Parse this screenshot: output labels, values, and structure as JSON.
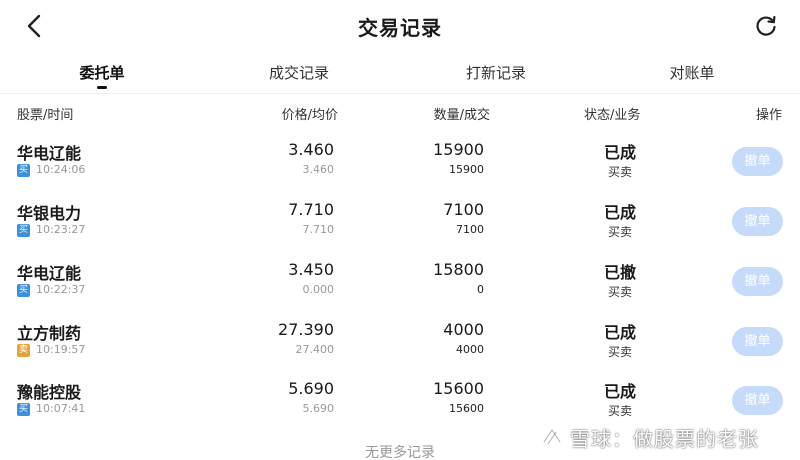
{
  "header": {
    "title": "交易记录",
    "back_icon": "chevron-left-icon",
    "refresh_icon": "refresh-icon"
  },
  "tabs": [
    {
      "label": "委托单",
      "active": true
    },
    {
      "label": "成交记录",
      "active": false
    },
    {
      "label": "打新记录",
      "active": false
    },
    {
      "label": "对账单",
      "active": false
    }
  ],
  "columns": {
    "stock_time": "股票/时间",
    "price": "价格/均价",
    "quantity": "数量/成交",
    "status": "状态/业务",
    "action": "操作"
  },
  "rows": [
    {
      "name": "华电辽能",
      "side": "买",
      "side_type": "buy",
      "time": "10:24:06",
      "price": "3.460",
      "avg_price": "3.460",
      "quantity": "15900",
      "filled": "15900",
      "status": "已成",
      "business": "买卖",
      "action": "撤单"
    },
    {
      "name": "华银电力",
      "side": "买",
      "side_type": "buy",
      "time": "10:23:27",
      "price": "7.710",
      "avg_price": "7.710",
      "quantity": "7100",
      "filled": "7100",
      "status": "已成",
      "business": "买卖",
      "action": "撤单"
    },
    {
      "name": "华电辽能",
      "side": "买",
      "side_type": "buy",
      "time": "10:22:37",
      "price": "3.450",
      "avg_price": "0.000",
      "quantity": "15800",
      "filled": "0",
      "status": "已撤",
      "business": "买卖",
      "action": "撤单"
    },
    {
      "name": "立方制药",
      "side": "卖",
      "side_type": "sell",
      "time": "10:19:57",
      "price": "27.390",
      "avg_price": "27.400",
      "quantity": "4000",
      "filled": "4000",
      "status": "已成",
      "business": "买卖",
      "action": "撤单"
    },
    {
      "name": "豫能控股",
      "side": "买",
      "side_type": "buy",
      "time": "10:07:41",
      "price": "5.690",
      "avg_price": "5.690",
      "quantity": "15600",
      "filled": "15600",
      "status": "已成",
      "business": "买卖",
      "action": "撤单"
    }
  ],
  "footer": {
    "no_more": "无更多记录"
  },
  "watermark": {
    "text": "雪球：做股票的老张"
  },
  "colors": {
    "buy_tag": "#3d8fe0",
    "sell_tag": "#e8a23a",
    "cancel_button": "#c6dafa"
  }
}
